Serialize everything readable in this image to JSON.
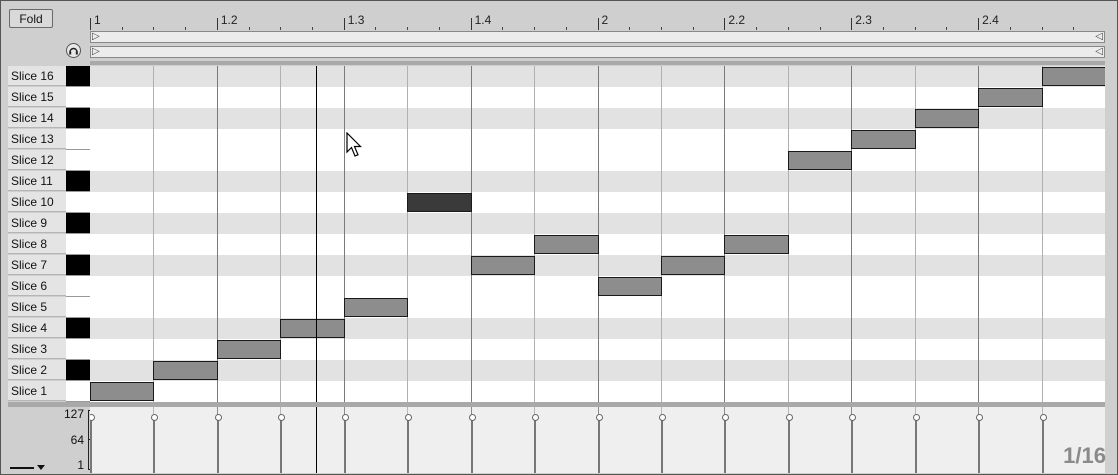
{
  "toolbar": {
    "fold_label": "Fold",
    "preview_icon": "headphones-icon"
  },
  "ruler": {
    "bars": [
      {
        "label": "1",
        "pos": 0
      },
      {
        "label": "1.2",
        "pos": 1
      },
      {
        "label": "1.3",
        "pos": 2
      },
      {
        "label": "1.4",
        "pos": 3
      },
      {
        "label": "2",
        "pos": 4
      },
      {
        "label": "2.2",
        "pos": 5
      },
      {
        "label": "2.3",
        "pos": 6
      },
      {
        "label": "2.4",
        "pos": 7
      }
    ]
  },
  "rows": [
    {
      "name": "Slice 16",
      "key": "black"
    },
    {
      "name": "Slice 15",
      "key": "white"
    },
    {
      "name": "Slice 14",
      "key": "black"
    },
    {
      "name": "Slice 13",
      "key": "white"
    },
    {
      "name": "Slice 12",
      "key": "white"
    },
    {
      "name": "Slice 11",
      "key": "black"
    },
    {
      "name": "Slice 10",
      "key": "white"
    },
    {
      "name": "Slice 9",
      "key": "black"
    },
    {
      "name": "Slice 8",
      "key": "white"
    },
    {
      "name": "Slice 7",
      "key": "black"
    },
    {
      "name": "Slice 6",
      "key": "white"
    },
    {
      "name": "Slice 5",
      "key": "white"
    },
    {
      "name": "Slice 4",
      "key": "black"
    },
    {
      "name": "Slice 3",
      "key": "white"
    },
    {
      "name": "Slice 2",
      "key": "black"
    },
    {
      "name": "Slice 1",
      "key": "white"
    }
  ],
  "notes": [
    {
      "step": 0,
      "slice": 1
    },
    {
      "step": 1,
      "slice": 2
    },
    {
      "step": 2,
      "slice": 3
    },
    {
      "step": 3,
      "slice": 4
    },
    {
      "step": 4,
      "slice": 5
    },
    {
      "step": 5,
      "slice": 10,
      "selected": true
    },
    {
      "step": 6,
      "slice": 7
    },
    {
      "step": 7,
      "slice": 8
    },
    {
      "step": 8,
      "slice": 6
    },
    {
      "step": 9,
      "slice": 7
    },
    {
      "step": 10,
      "slice": 8
    },
    {
      "step": 11,
      "slice": 12
    },
    {
      "step": 12,
      "slice": 13
    },
    {
      "step": 13,
      "slice": 14
    },
    {
      "step": 14,
      "slice": 15
    },
    {
      "step": 15,
      "slice": 16
    }
  ],
  "velocity": {
    "labels": [
      "127",
      "64",
      "1"
    ],
    "values": [
      127,
      127,
      127,
      127,
      127,
      127,
      127,
      127,
      127,
      127,
      127,
      127,
      127,
      127,
      127,
      127
    ]
  },
  "grid_resolution": "1/16",
  "colors": {
    "note": "#8d8d8d",
    "note_selected": "#3a3a3a",
    "black_key": "#000000"
  }
}
